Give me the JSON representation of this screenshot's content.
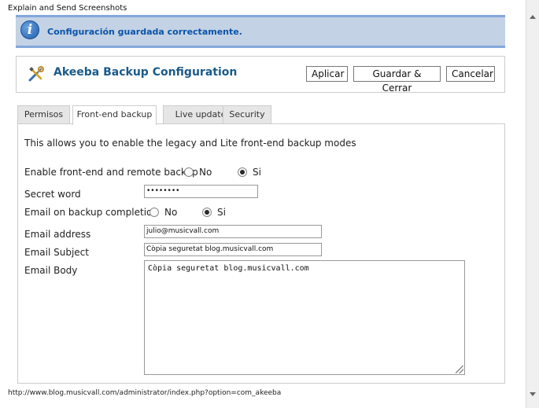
{
  "window": {
    "title": "Explain and Send Screenshots"
  },
  "message": {
    "text": "Configuración guardada correctamente.",
    "icon": "info-icon"
  },
  "toolbar": {
    "title": "Akeeba Backup Configuration",
    "icon": "tools-icon",
    "apply_label": "Aplicar",
    "save_close_label": "Guardar & Cerrar",
    "cancel_label": "Cancelar"
  },
  "tabs": [
    {
      "label": "Permisos",
      "active": false
    },
    {
      "label": "Front-end backup",
      "active": true
    },
    {
      "label": "Live update",
      "active": false
    },
    {
      "label": "Security",
      "active": false
    }
  ],
  "form": {
    "intro": "This allows you to enable the legacy and Lite front-end backup modes",
    "frontend_backup": {
      "label": "Enable front-end and remote backup",
      "options": [
        "No",
        "Si"
      ],
      "selected": "Si"
    },
    "secret_word": {
      "label": "Secret word",
      "value": "••••••••"
    },
    "email_on_completion": {
      "label": "Email on backup completion",
      "options": [
        "No",
        "Si"
      ],
      "selected": "Si"
    },
    "email_address": {
      "label": "Email address",
      "value": "julio@musicvall.com"
    },
    "email_subject": {
      "label": "Email Subject",
      "value": "Còpia seguretat blog.musicvall.com"
    },
    "email_body": {
      "label": "Email Body",
      "value": "Còpia seguretat blog.musicvall.com"
    }
  },
  "status_bar": {
    "url": "http://www.blog.musicvall.com/administrator/index.php?option=com_akeeba"
  },
  "colors": {
    "message_bg": "#c3d2e5",
    "message_border": "#84a7db",
    "message_text": "#0a53a8",
    "title_text": "#1a5a8a"
  }
}
